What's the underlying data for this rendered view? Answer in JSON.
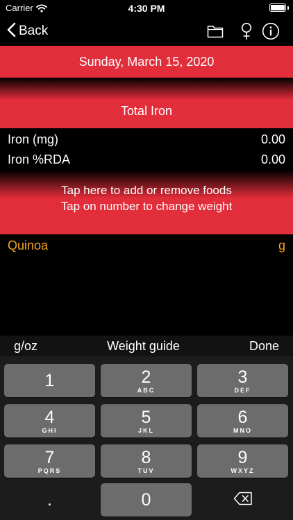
{
  "status_bar": {
    "carrier": "Carrier",
    "time": "4:30 PM",
    "battery_level": 1.0
  },
  "nav": {
    "back_label": "Back",
    "icons": [
      "folder-icon",
      "female-symbol-icon",
      "info-icon"
    ]
  },
  "date": "Sunday, March 15, 2020",
  "total_label": "Total Iron",
  "nutrients": [
    {
      "label": "Iron (mg)",
      "value": "0.00"
    },
    {
      "label": "Iron %RDA",
      "value": "0.00"
    }
  ],
  "instructions": {
    "line1": "Tap here to add or remove foods",
    "line2": "Tap on number to change weight"
  },
  "foods": [
    {
      "name": "Quinoa",
      "unit": "g"
    }
  ],
  "keyboard_toolbar": {
    "unit_toggle": "g/oz",
    "weight_guide": "Weight guide",
    "done": "Done"
  },
  "keypad": {
    "k1": {
      "num": "1",
      "letters": ""
    },
    "k2": {
      "num": "2",
      "letters": "ABC"
    },
    "k3": {
      "num": "3",
      "letters": "DEF"
    },
    "k4": {
      "num": "4",
      "letters": "GHI"
    },
    "k5": {
      "num": "5",
      "letters": "JKL"
    },
    "k6": {
      "num": "6",
      "letters": "MNO"
    },
    "k7": {
      "num": "7",
      "letters": "PQRS"
    },
    "k8": {
      "num": "8",
      "letters": "TUV"
    },
    "k9": {
      "num": "9",
      "letters": "WXYZ"
    },
    "k0": {
      "num": "0",
      "letters": ""
    },
    "decimal": "."
  },
  "colors": {
    "accent_red": "#e22d3a",
    "food_orange": "#f5a623",
    "key_gray": "#6c6c6c"
  }
}
